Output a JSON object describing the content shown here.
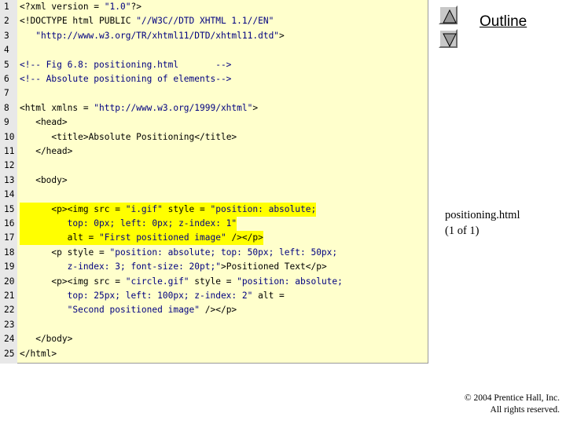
{
  "outline": {
    "title": "Outline",
    "up_icon": "triangle-up-icon",
    "down_icon": "triangle-down-icon"
  },
  "caption": {
    "file": "positioning.html",
    "page": "(1 of 1)"
  },
  "copyright": {
    "line1": "© 2004 Prentice Hall, Inc.",
    "line2": "All rights reserved."
  },
  "colors": {
    "code_bg": "#ffffcc",
    "highlight": "#ffff00",
    "gutter": "#e8e8e8",
    "string_blue": "#000080"
  },
  "code": [
    {
      "n": "1",
      "segs": [
        [
          "k",
          "<?xml version = "
        ],
        [
          "s",
          "\"1.0\""
        ],
        [
          "k",
          "?>"
        ]
      ]
    },
    {
      "n": "2",
      "segs": [
        [
          "k",
          "<!DOCTYPE html PUBLIC "
        ],
        [
          "s",
          "\"//W3C//DTD XHTML 1.1//EN\""
        ]
      ]
    },
    {
      "n": "3",
      "segs": [
        [
          "s",
          "   \"http://www.w3.org/TR/xhtml11/DTD/xhtml11.dtd\""
        ],
        [
          "k",
          ">"
        ]
      ]
    },
    {
      "n": "4",
      "segs": []
    },
    {
      "n": "5",
      "segs": [
        [
          "c",
          "<!-- Fig 6.8: positioning.html       -->"
        ]
      ]
    },
    {
      "n": "6",
      "segs": [
        [
          "c",
          "<!-- Absolute positioning of elements-->"
        ]
      ]
    },
    {
      "n": "7",
      "segs": []
    },
    {
      "n": "8",
      "segs": [
        [
          "k",
          "<html xmlns = "
        ],
        [
          "s",
          "\"http://www.w3.org/1999/xhtml\""
        ],
        [
          "k",
          ">"
        ]
      ]
    },
    {
      "n": "9",
      "segs": [
        [
          "k",
          "   <head>"
        ]
      ]
    },
    {
      "n": "10",
      "segs": [
        [
          "k",
          "      <title>"
        ],
        [
          "k",
          "Absolute Positioning"
        ],
        [
          "k",
          "</title>"
        ]
      ]
    },
    {
      "n": "11",
      "segs": [
        [
          "k",
          "   </head>"
        ]
      ]
    },
    {
      "n": "12",
      "segs": []
    },
    {
      "n": "13",
      "segs": [
        [
          "k",
          "   <body>"
        ]
      ]
    },
    {
      "n": "14",
      "segs": []
    },
    {
      "n": "15",
      "hl": true,
      "segs": [
        [
          "k",
          "      <p><img src = "
        ],
        [
          "s",
          "\"i.gif\""
        ],
        [
          "k",
          " style = "
        ],
        [
          "s",
          "\"position: absolute;"
        ]
      ]
    },
    {
      "n": "16",
      "hl": true,
      "segs": [
        [
          "s",
          "         top: 0px; left: 0px; z-index: 1\""
        ]
      ]
    },
    {
      "n": "17",
      "hl": true,
      "segs": [
        [
          "k",
          "         alt = "
        ],
        [
          "s",
          "\"First positioned image\""
        ],
        [
          "k",
          " /></p>"
        ]
      ]
    },
    {
      "n": "18",
      "segs": [
        [
          "k",
          "      <p style = "
        ],
        [
          "s",
          "\"position: absolute; top: 50px; left: 50px;"
        ]
      ]
    },
    {
      "n": "19",
      "segs": [
        [
          "s",
          "         z-index: 3; font-size: 20pt;\""
        ],
        [
          "k",
          ">"
        ],
        [
          "k",
          "Positioned Text"
        ],
        [
          "k",
          "</p>"
        ]
      ]
    },
    {
      "n": "20",
      "segs": [
        [
          "k",
          "      <p><img src = "
        ],
        [
          "s",
          "\"circle.gif\""
        ],
        [
          "k",
          " style = "
        ],
        [
          "s",
          "\"position: absolute;"
        ]
      ]
    },
    {
      "n": "21",
      "segs": [
        [
          "s",
          "         top: 25px; left: 100px; z-index: 2\""
        ],
        [
          "k",
          " alt = "
        ]
      ]
    },
    {
      "n": "22",
      "segs": [
        [
          "s",
          "         \"Second positioned image\""
        ],
        [
          "k",
          " /></p>"
        ]
      ]
    },
    {
      "n": "23",
      "segs": []
    },
    {
      "n": "24",
      "segs": [
        [
          "k",
          "   </body>"
        ]
      ]
    },
    {
      "n": "25",
      "segs": [
        [
          "k",
          "</html>"
        ]
      ]
    }
  ]
}
